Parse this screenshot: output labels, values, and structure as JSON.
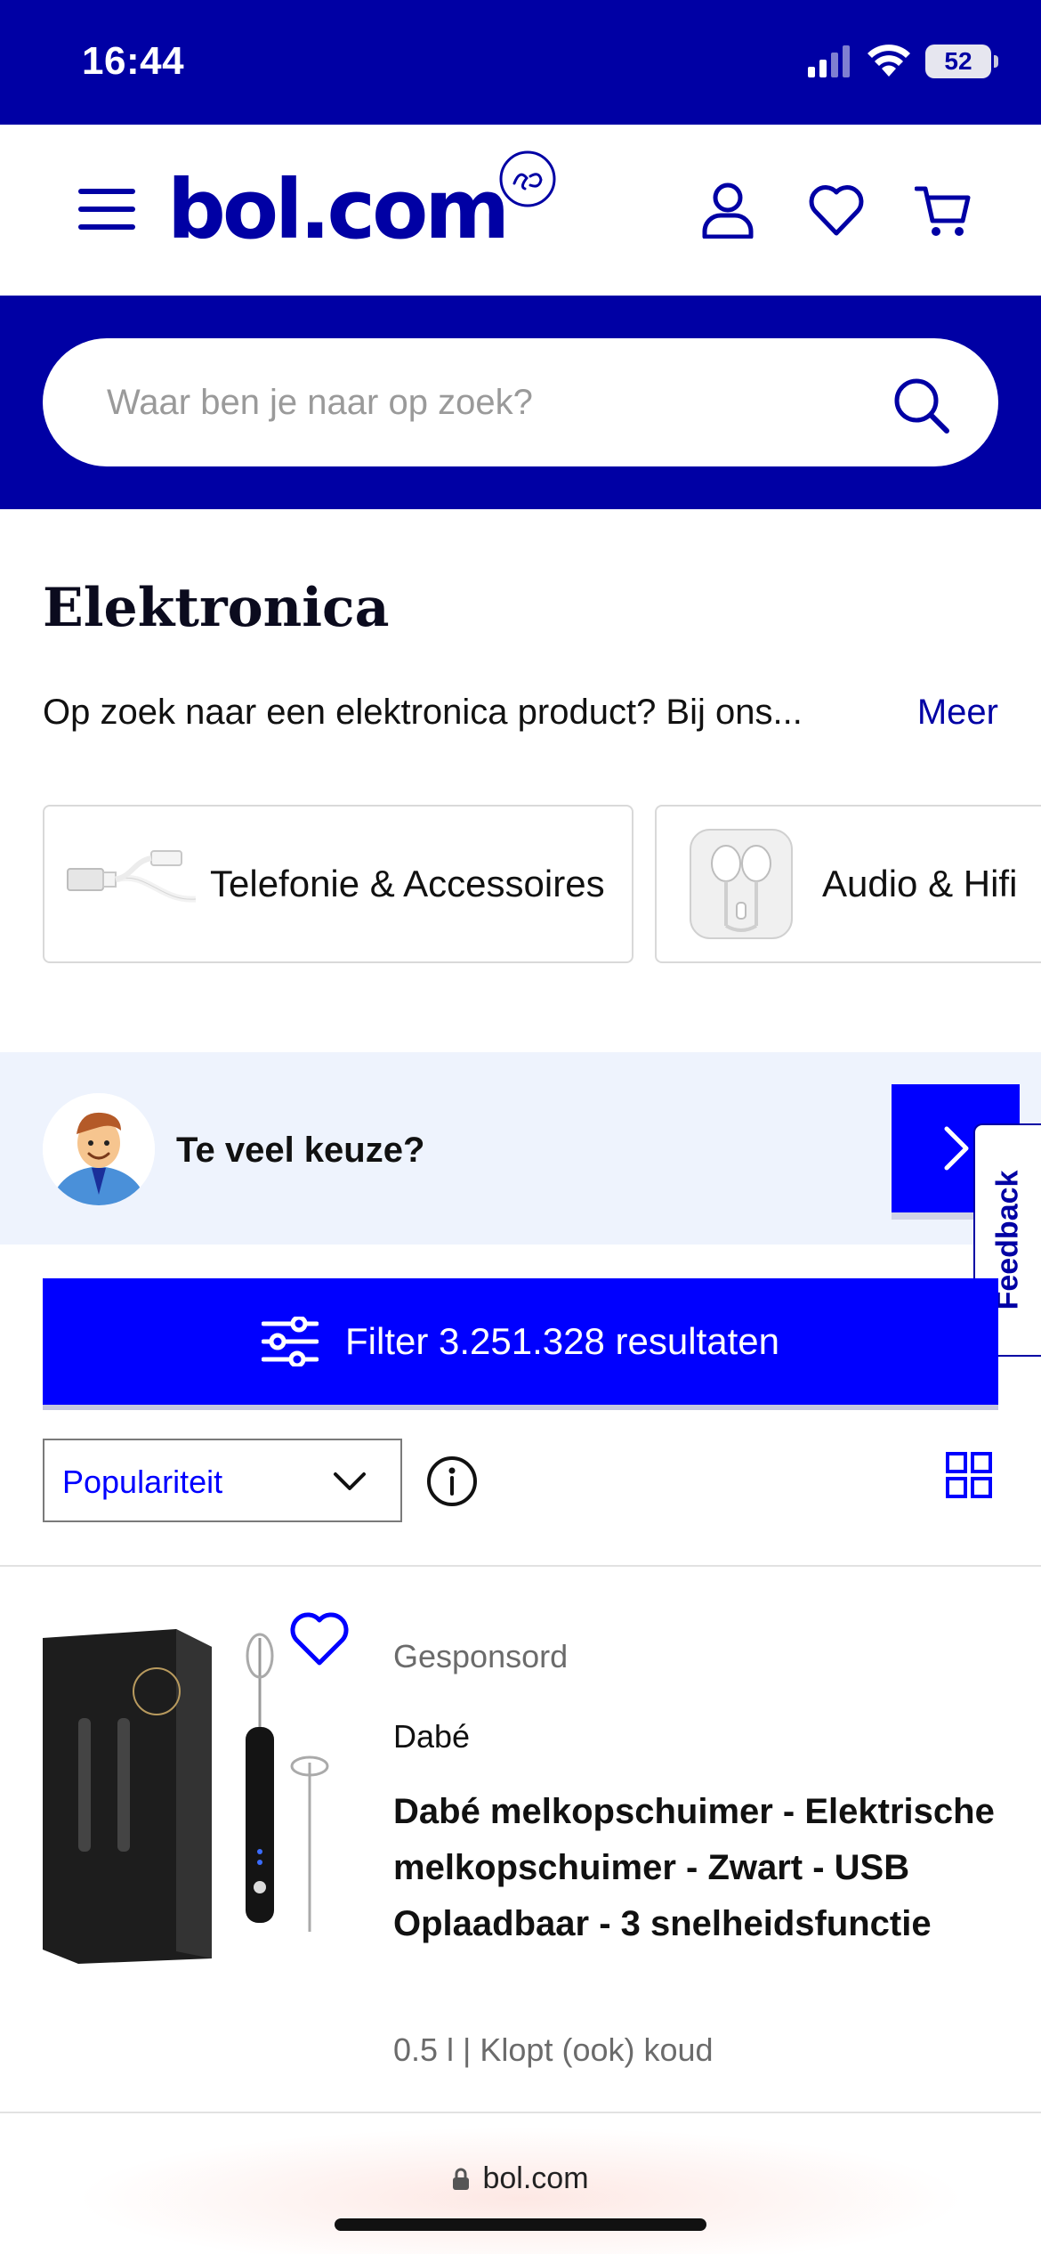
{
  "status_bar": {
    "time": "16:44",
    "battery": "52"
  },
  "header": {
    "logo": "bol.com"
  },
  "search": {
    "placeholder": "Waar ben je naar op zoek?"
  },
  "category": {
    "title": "Elektronica",
    "intro": "Op zoek naar een elektronica product? Bij ons...",
    "more_link": "Meer",
    "tiles": [
      {
        "label": "Telefonie & Accessoires",
        "icon": "usb-cable-icon"
      },
      {
        "label": "Audio & Hifi",
        "icon": "earphones-icon"
      }
    ]
  },
  "help_banner": {
    "text": "Te veel keuze?"
  },
  "feedback": {
    "label": "Feedback"
  },
  "filter": {
    "label": "Filter 3.251.328 resultaten"
  },
  "sort": {
    "selected": "Populariteit"
  },
  "product": {
    "sponsored": "Gesponsord",
    "brand": "Dabé",
    "title": "Dabé melkopschuimer - Elektrische melkopschuimer - Zwart - USB Oplaadbaar - 3 snelheidsfunctie",
    "meta": "0.5 l | Klopt (ook) koud"
  },
  "browser": {
    "url": "bol.com"
  },
  "colors": {
    "brand_dark": "#0000a4",
    "brand_blue": "#0000ff",
    "banner_bg": "#eef3fd"
  }
}
